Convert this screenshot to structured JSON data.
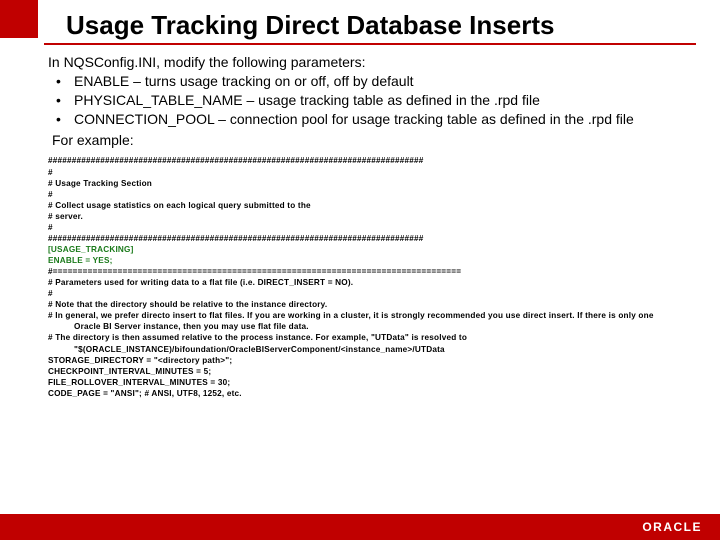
{
  "title": "Usage Tracking Direct Database Inserts",
  "intro": "In NQSConfig.INI, modify the following parameters:",
  "bullets": [
    "ENABLE – turns usage tracking on or off, off by default",
    "PHYSICAL_TABLE_NAME – usage tracking table as defined in the .rpd file",
    "CONNECTION_POOL – connection pool for usage tracking table as defined in the .rpd file"
  ],
  "example_label": "For example:",
  "code": {
    "l1": "###############################################################################",
    "l2": "#",
    "l3": "#  Usage Tracking Section",
    "l4": "#",
    "l5": "#  Collect usage statistics on each logical query submitted to the",
    "l6": "#  server.",
    "l7": "#",
    "l8": "###############################################################################",
    "l9": "[USAGE_TRACKING]",
    "l10": "ENABLE = YES;",
    "l11": "#==================================================================================",
    "l12": "# Parameters used for writing data to a flat file (i.e. DIRECT_INSERT = NO).",
    "l13": "#",
    "l14": "# Note that the directory should be relative to the instance directory.",
    "l15": "# In general, we prefer directo insert to flat files.  If you are working in a cluster, it is strongly recommended you use direct insert.  If there is only one",
    "l15b": "Oracle BI Server instance, then you may use flat file data.",
    "l16": "# The directory is then assumed relative to the process instance.  For example, \"UTData\" is resolved to",
    "l16b": "\"$(ORACLE_INSTANCE)/bifoundation/OracleBIServerComponent/<instance_name>/UTData",
    "l17": "STORAGE_DIRECTORY = \"<directory path>\";",
    "l18": "CHECKPOINT_INTERVAL_MINUTES = 5;",
    "l19": "FILE_ROLLOVER_INTERVAL_MINUTES = 30;",
    "l20": "CODE_PAGE = \"ANSI\"; # ANSI, UTF8, 1252, etc."
  },
  "logo_text": "ORACLE"
}
